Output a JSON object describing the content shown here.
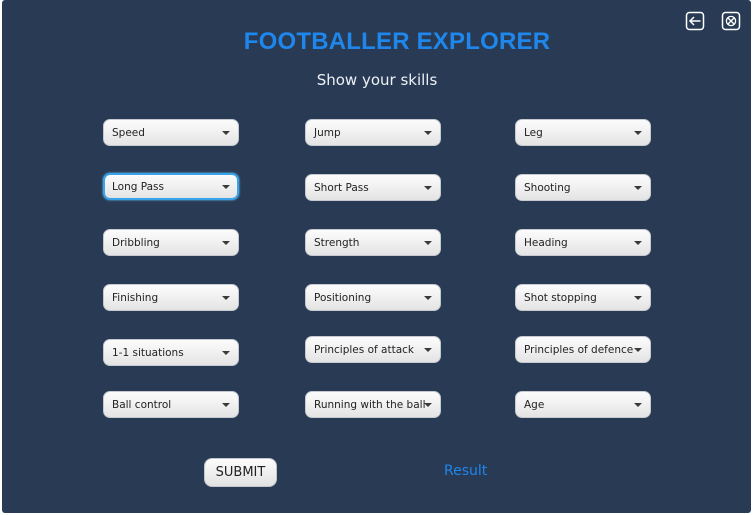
{
  "app": {
    "title": "FOOTBALLER EXPLORER",
    "subtitle": "Show your skills"
  },
  "window_controls": [
    {
      "icon": "back-arrow-icon"
    },
    {
      "icon": "close-icon"
    }
  ],
  "skills": [
    {
      "label": "Speed"
    },
    {
      "label": "Jump"
    },
    {
      "label": "Leg"
    },
    {
      "label": "Long Pass",
      "focused": true
    },
    {
      "label": "Short Pass"
    },
    {
      "label": "Shooting"
    },
    {
      "label": "Dribbling"
    },
    {
      "label": "Strength"
    },
    {
      "label": "Heading"
    },
    {
      "label": "Finishing"
    },
    {
      "label": "Positioning"
    },
    {
      "label": "Shot stopping"
    },
    {
      "label": "1-1 situations"
    },
    {
      "label": "Principles of attack"
    },
    {
      "label": "Principles of defence"
    },
    {
      "label": "Ball control"
    },
    {
      "label": "Running with the ball"
    },
    {
      "label": "Age"
    }
  ],
  "actions": {
    "submit_label": "SUBMIT",
    "result_label": "Result"
  },
  "colors": {
    "background": "#283a54",
    "accent": "#1f86ec",
    "focus_ring": "#3aa3e9"
  }
}
